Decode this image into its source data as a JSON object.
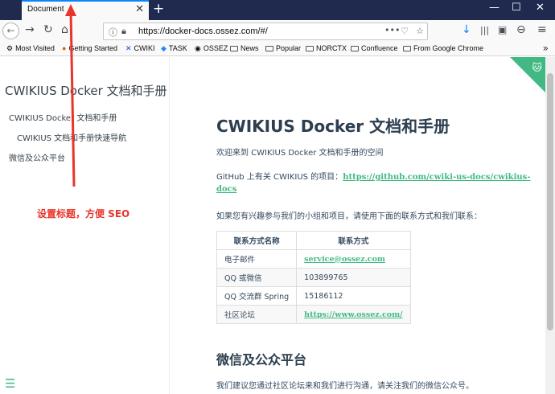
{
  "tab": {
    "title": "Document",
    "close": "✕",
    "new": "+"
  },
  "window_controls": {
    "minimize": "—",
    "maximize": "☐",
    "close": "✕"
  },
  "nav": {
    "back": "←",
    "forward": "→",
    "reload": "↻",
    "home": "⌂",
    "url": "https://docker-docs.ossez.com/#/",
    "more": "•••",
    "pocket": "♡",
    "star": "☆",
    "download": "↓",
    "library": "|||",
    "sidebar": "▣",
    "account": "⊖",
    "menu": "≡"
  },
  "bookmarks": {
    "items": [
      "Most Visited",
      "Getting Started",
      "CWIKI",
      "TASK",
      "OSSEZ",
      "News",
      "Popular",
      "NORCTX",
      "Confluence",
      "From Google Chrome"
    ],
    "more": "»"
  },
  "sidebar": {
    "title": "CWIKIUS Docker 文档和手册",
    "items": [
      "CWIKIUS Docker 文档和手册",
      "CWIKIUS 文档和手册快速导航",
      "微信及公众平台"
    ],
    "menu_icon": "☰"
  },
  "content": {
    "title": "CWIKIUS Docker 文档和手册",
    "welcome": "欢迎来到 CWIKIUS Docker 文档和手册的空间",
    "github_prefix": "GitHub 上有关 CWIKIUS 的项目：",
    "github_link_line1": "https://github.com/cwiki-us-docs/cwikius-",
    "github_link_line2": "docs",
    "contact_intro": "如果您有兴趣参与我们的小组和项目，请使用下面的联系方式和我们联系：",
    "table": {
      "headers": [
        "联系方式名称",
        "联系方式"
      ],
      "rows": [
        [
          "电子邮件",
          "service@ossez.com"
        ],
        [
          "QQ 或微信",
          "103899765"
        ],
        [
          "QQ 交流群 Spring",
          "15186112"
        ],
        [
          "社区论坛",
          "https://www.ossez.com/"
        ]
      ]
    },
    "section2_title": "微信及公众平台",
    "section2_text": "我们建议您通过社区论坛来和我们进行沟通，请关注我们的微信公众号。"
  },
  "annotation": {
    "text": "设置标题，方便 SEO",
    "color": "#e8352b"
  },
  "colors": {
    "accent": "#42b983",
    "tabbar": "#1f2a4e",
    "tab_highlight": "#0a84ff"
  }
}
